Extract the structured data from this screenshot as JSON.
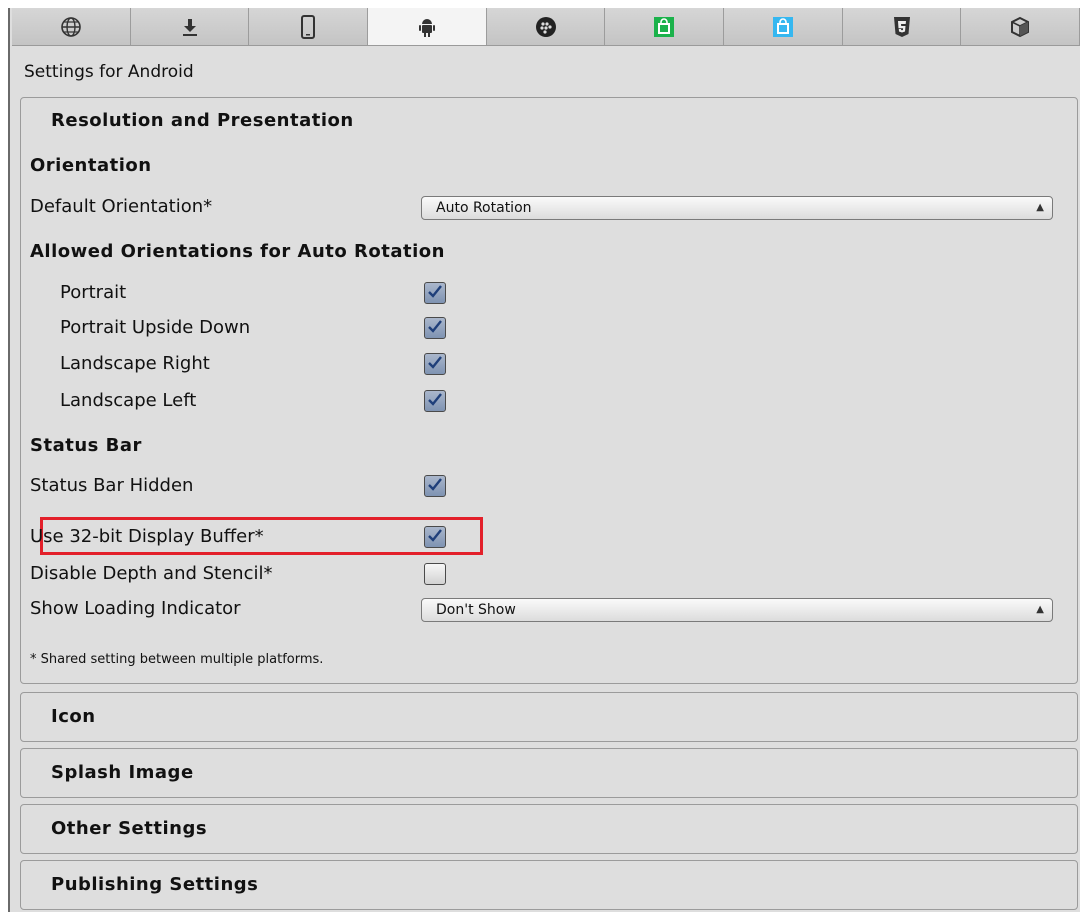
{
  "platform_tabs": [
    {
      "name": "web-player",
      "icon": "globe-icon"
    },
    {
      "name": "standalone",
      "icon": "download-icon"
    },
    {
      "name": "ios",
      "icon": "phone-icon"
    },
    {
      "name": "android",
      "icon": "android-icon",
      "active": true
    },
    {
      "name": "blackberry",
      "icon": "blackberry-icon"
    },
    {
      "name": "windows-store",
      "icon": "windows-store-green-icon"
    },
    {
      "name": "windows-phone",
      "icon": "windows-store-blue-icon"
    },
    {
      "name": "webgl",
      "icon": "html5-icon"
    },
    {
      "name": "samsung-tv",
      "icon": "unity-cube-icon"
    }
  ],
  "colors": {
    "panel_bg": "#dedede",
    "checkbox_checked": "#8a9cb8",
    "highlight": "#e3202a",
    "accent_green": "#1bb24b",
    "accent_blue": "#35b7f0"
  },
  "header": {
    "title": "Settings for Android"
  },
  "resolution": {
    "title": "Resolution and Presentation",
    "orientation_heading": "Orientation",
    "default_orientation_label": "Default Orientation*",
    "default_orientation_value": "Auto Rotation",
    "allowed_heading": "Allowed Orientations for Auto Rotation",
    "allowed": [
      {
        "label": "Portrait",
        "checked": true
      },
      {
        "label": "Portrait Upside Down",
        "checked": true
      },
      {
        "label": "Landscape Right",
        "checked": true
      },
      {
        "label": "Landscape Left",
        "checked": true
      }
    ],
    "status_bar_heading": "Status Bar",
    "status_bar_hidden_label": "Status Bar Hidden",
    "status_bar_hidden": true,
    "use_32bit_label": "Use 32-bit Display Buffer*",
    "use_32bit": true,
    "disable_depth_label": "Disable Depth and Stencil*",
    "disable_depth": false,
    "loading_indicator_label": "Show Loading Indicator",
    "loading_indicator_value": "Don't Show",
    "footnote": "* Shared setting between multiple platforms."
  },
  "collapsed_sections": [
    {
      "title": "Icon"
    },
    {
      "title": "Splash Image"
    },
    {
      "title": "Other Settings"
    },
    {
      "title": "Publishing Settings"
    }
  ]
}
